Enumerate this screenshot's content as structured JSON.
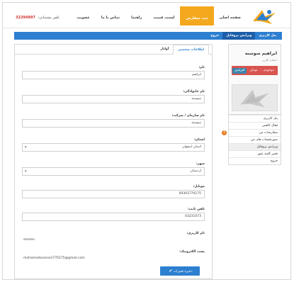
{
  "header": {
    "nav": [
      {
        "label": "صفحه اصلی",
        "active": false
      },
      {
        "label": "ثبت سفارش",
        "active": true
      },
      {
        "label": "لیست قیمت",
        "active": false
      },
      {
        "label": "راهنما",
        "active": false
      },
      {
        "label": "تماس با ما",
        "active": false
      },
      {
        "label": "عضویت",
        "active": false
      }
    ],
    "support_label": "تلفن پشتیبانی:",
    "support_phone": "32294997"
  },
  "bluebar": {
    "items": [
      {
        "label": "پنل کاربری",
        "active": false
      },
      {
        "label": "ویرایش پروفایل",
        "active": true
      },
      {
        "label": "خروج",
        "active": false
      }
    ]
  },
  "sidebar": {
    "name": "ابراهیم سوسنه",
    "subtitle": "حساب کاربر",
    "credit_text": "موجودی : ۰ تومان",
    "credit_button": "افزایش",
    "menu": [
      {
        "label": "پنل کاربری",
        "active": false,
        "warn": false
      },
      {
        "label": "فعال کاهش",
        "active": false,
        "warn": false
      },
      {
        "label": "سفارشات من",
        "active": false,
        "warn": true
      },
      {
        "label": "صورتحساب های من",
        "active": false,
        "warn": false
      },
      {
        "label": "ویرایش پروفایل",
        "active": true,
        "warn": false
      },
      {
        "label": "تغییر کلمه عبور",
        "active": false,
        "warn": false
      },
      {
        "label": "خروج",
        "active": false,
        "warn": false
      }
    ],
    "warn_symbol": "!"
  },
  "panel": {
    "tabs": [
      {
        "label": "اطلاعات شخصی",
        "active": true
      },
      {
        "label": "آواتار",
        "active": false
      }
    ],
    "fields": {
      "first_name": {
        "label": "نام:",
        "value": "ابراهیم"
      },
      "last_name": {
        "label": "نام خانوادگی:",
        "value": "سوسنه"
      },
      "company": {
        "label": "نام سازمان / شرکت:",
        "value": "سوسنه"
      },
      "province": {
        "label": "استان:",
        "value": "استان اصفهان"
      },
      "city": {
        "label": "شهر:",
        "value": "اردستان"
      },
      "mobile": {
        "label": "موبایل:",
        "value": "09301770175"
      },
      "phone": {
        "label": "تلفن ثابت:",
        "value": "03231073"
      },
      "username": {
        "label": "نام کاربری:",
        "value": "sosnen"
      },
      "email": {
        "label": "پست الکترونیک:",
        "value": "mohamadsosane1770175@gmail.com"
      }
    },
    "save_label": "ذخیره تغییرات",
    "save_icon": "check-icon"
  },
  "colors": {
    "accent_blue": "#2d7fd0",
    "nav_active": "#f3a81e",
    "credit_red": "#d9534f",
    "warn_orange": "#e67e22"
  }
}
